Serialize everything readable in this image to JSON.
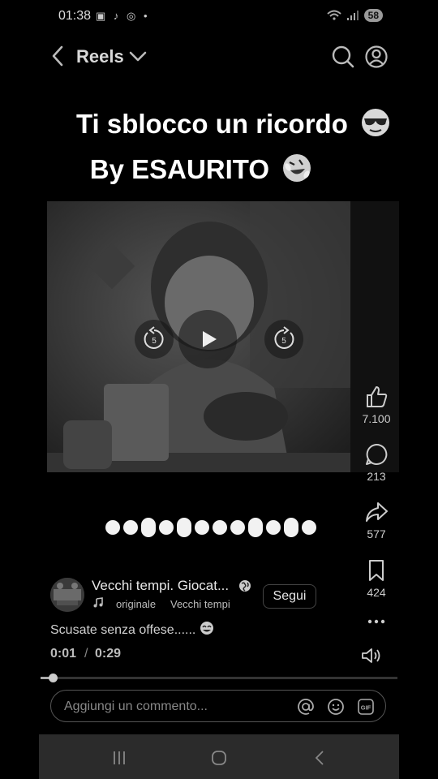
{
  "status_bar": {
    "time": "01:38",
    "battery": "58"
  },
  "header": {
    "title": "Reels"
  },
  "caption": {
    "line1": "Ti sblocco un ricordo",
    "line2": "By ESAURITO"
  },
  "actions": {
    "like_count": "7.100",
    "comment_count": "213",
    "share_count": "577",
    "save_count": "424"
  },
  "post": {
    "account_name": "Vecchi tempi. Giocat...",
    "follow_label": "Segui",
    "audio_label": "originale",
    "audio_source": "Vecchi tempi",
    "description": "Scusate senza offese......"
  },
  "player": {
    "current_time": "0:01",
    "separator": "/",
    "total_time": "0:29",
    "progress": 0.035
  },
  "comment": {
    "placeholder": "Aggiungi un commento..."
  },
  "icons": {
    "back": "chevron-left-icon",
    "dropdown": "chevron-down-icon",
    "search": "search-icon",
    "profile": "profile-icon",
    "like": "thumbs-up-icon",
    "comment": "comment-icon",
    "share": "share-icon",
    "save": "bookmark-icon",
    "more": "more-icon",
    "volume": "volume-icon"
  }
}
